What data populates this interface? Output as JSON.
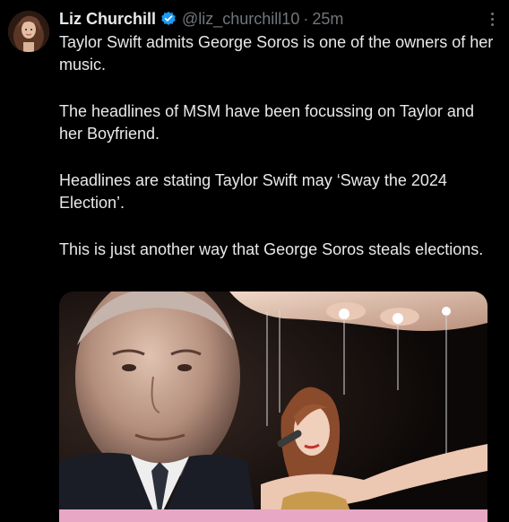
{
  "tweet": {
    "author_name": "Liz Churchill",
    "author_handle": "@liz_churchill10",
    "separator": "·",
    "timestamp": "25m",
    "verified": true,
    "text_paragraphs": [
      "Taylor Swift admits George Soros is one of the owners of her music.",
      "The headlines of MSM have been focussing on Taylor and her Boyfriend.",
      "Headlines are stating Taylor Swift may ‘Sway the 2024 Election’.",
      "This is just another way that George Soros steals elections."
    ]
  },
  "icons": {
    "verified": "verified-badge-icon",
    "more": "more-options-icon"
  },
  "colors": {
    "background": "#000000",
    "text": "#e7e9ea",
    "muted": "#71767b",
    "verified_blue": "#1d9bf0",
    "media_pink": "#e8a7c4"
  }
}
